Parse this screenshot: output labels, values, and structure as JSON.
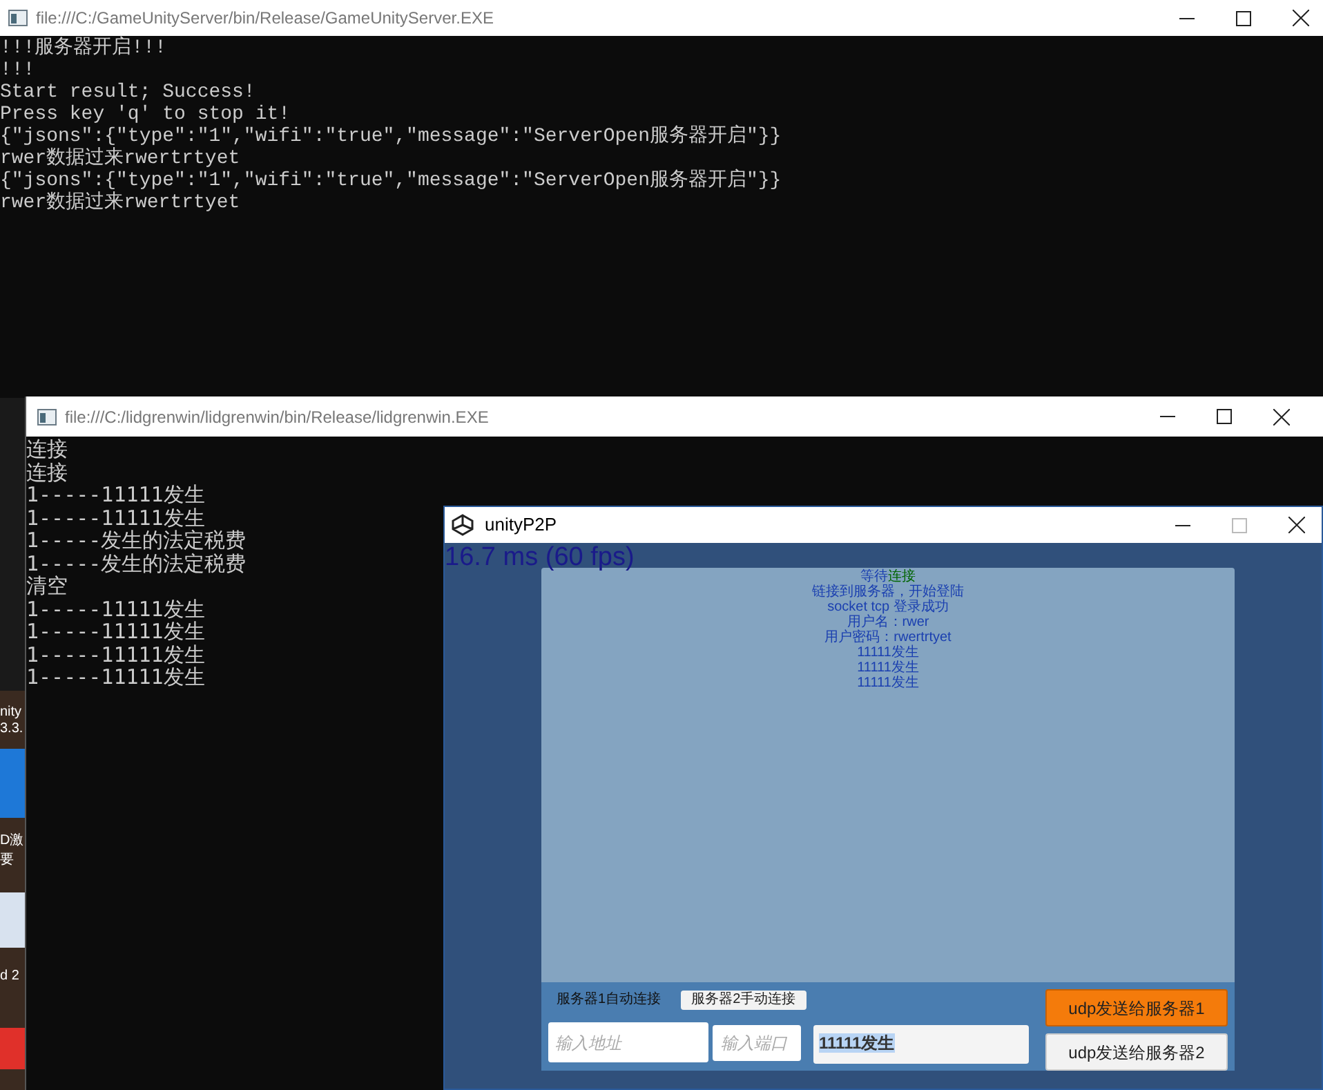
{
  "desktop": {
    "icon_labels": [
      "nity",
      "3.3.",
      "D激",
      "要",
      "d 2"
    ]
  },
  "server_console": {
    "title": "file:///C:/GameUnityServer/bin/Release/GameUnityServer.EXE",
    "lines": [
      "!!!服务器开启!!!",
      "!!!",
      "Start result; Success!",
      "Press key 'q' to stop it!",
      "{\"jsons\":{\"type\":\"1\",\"wifi\":\"true\",\"message\":\"ServerOpen服务器开启\"}}",
      "rwer数据过来rwertrtyet",
      "{\"jsons\":{\"type\":\"1\",\"wifi\":\"true\",\"message\":\"ServerOpen服务器开启\"}}",
      "rwer数据过来rwertrtyet"
    ]
  },
  "client_console": {
    "title": "file:///C:/lidgrenwin/lidgrenwin/bin/Release/lidgrenwin.EXE",
    "lines": [
      "连接",
      "连接",
      "1-----11111发生",
      "1-----11111发生",
      "1-----发生的法定税费",
      "1-----发生的法定税费",
      "清空",
      "1-----11111发生",
      "1-----11111发生",
      "1-----11111发生",
      "1-----11111发生"
    ]
  },
  "unity_window": {
    "title": "unityP2P",
    "fps": "16.7 ms (60 fps)",
    "log": [
      {
        "text": "等待",
        "highlight": "连接"
      },
      {
        "text": "链接到服务器，开始登陆"
      },
      {
        "text": "socket tcp 登录成功"
      },
      {
        "text": "用户名：rwer"
      },
      {
        "text": "用户密码：rwertrtyet"
      },
      {
        "text": "11111发生"
      },
      {
        "text": "11111发生"
      },
      {
        "text": "11111发生"
      }
    ],
    "server1_label": "服务器1自动连接",
    "server2_button": "服务器2手动连接",
    "address_field": {
      "placeholder": "输入地址"
    },
    "port_field": {
      "placeholder": "输入端口"
    },
    "message_field": {
      "value": "11111发生",
      "selected": true
    },
    "send_buttons": [
      {
        "label": "udp发送给服务器1",
        "highlighted": true
      },
      {
        "label": "udp发送给服务器2",
        "highlighted": false
      }
    ]
  }
}
